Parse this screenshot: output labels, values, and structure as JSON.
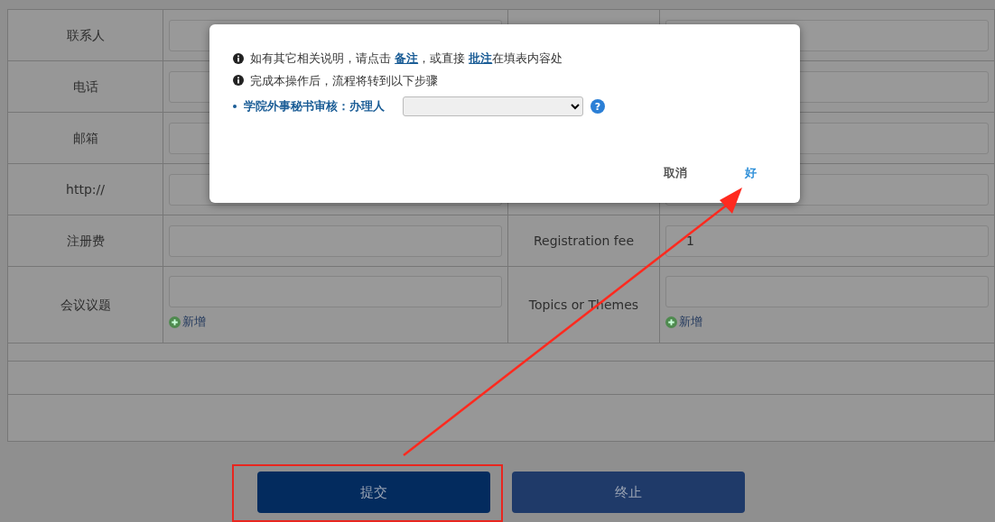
{
  "form": {
    "rows": [
      {
        "label": "联系人"
      },
      {
        "label": "电话"
      },
      {
        "label": "邮箱"
      },
      {
        "label": "http://"
      },
      {
        "label": "注册费",
        "label_en": "Registration fee",
        "value_en": "1"
      },
      {
        "label": "会议议题",
        "label_en": "Topics or Themes",
        "add_link": "新增",
        "add_link_en": "新增"
      }
    ]
  },
  "dialog": {
    "notes": [
      {
        "parts": [
          {
            "kind": "text",
            "text": "如有其它相关说明，请点击 "
          },
          {
            "kind": "link",
            "text": "备注"
          },
          {
            "kind": "text",
            "text": "，或直接 "
          },
          {
            "kind": "link",
            "text": "批注"
          },
          {
            "kind": "text",
            "text": "在填表内容处"
          }
        ]
      },
      {
        "parts": [
          {
            "kind": "text",
            "text": "完成本操作后，流程将转到以下步骤"
          }
        ]
      }
    ],
    "step": {
      "label": "学院外事秘书审核：办理人",
      "help": "?"
    },
    "buttons": [
      {
        "label": "取消",
        "kind": "cancel"
      },
      {
        "label": "好",
        "kind": "ok"
      }
    ]
  },
  "actions": [
    {
      "label": "提交",
      "kind": "primary",
      "highlighted": true
    },
    {
      "label": "终止",
      "kind": "secondary",
      "highlighted": false
    }
  ]
}
